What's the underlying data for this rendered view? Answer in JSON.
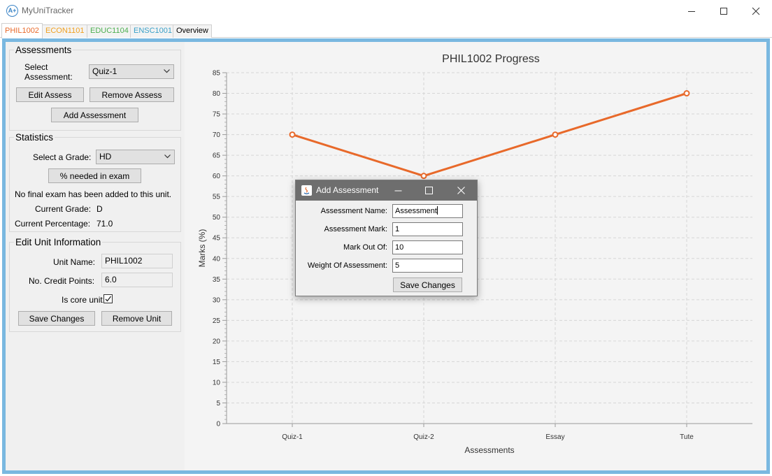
{
  "window": {
    "app_icon_glyph": "A+",
    "title": "MyUniTracker"
  },
  "tabs": [
    {
      "label": "PHIL1002",
      "color": "#e8692a",
      "active": true
    },
    {
      "label": "ECON1101",
      "color": "#f0a020",
      "active": false
    },
    {
      "label": "EDUC1104",
      "color": "#4caf50",
      "active": false
    },
    {
      "label": "ENSC1001",
      "color": "#3aa0c8",
      "active": false
    },
    {
      "label": "Overview",
      "color": "#000000",
      "active": false
    }
  ],
  "assessments_panel": {
    "title": "Assessments",
    "select_label": "Select Assessment:",
    "selected": "Quiz-1",
    "edit_button": "Edit Assess",
    "remove_button": "Remove Assess",
    "add_button": "Add Assessment"
  },
  "statistics_panel": {
    "title": "Statistics",
    "grade_label": "Select a Grade:",
    "grade_selected": "HD",
    "needed_button": "% needed in exam",
    "exam_message": "No final exam has been added to this unit.",
    "current_grade_label": "Current Grade:",
    "current_grade": "D",
    "current_pct_label": "Current Percentage:",
    "current_pct": "71.0"
  },
  "unit_panel": {
    "title": "Edit Unit Information",
    "name_label": "Unit Name:",
    "name_value": "PHIL1002",
    "credits_label": "No. Credit Points:",
    "credits_value": "6.0",
    "core_label": "Is core unit:",
    "core_checked": true,
    "save_button": "Save Changes",
    "remove_button": "Remove Unit"
  },
  "chart_data": {
    "type": "line",
    "title": "PHIL1002 Progress",
    "xlabel": "Assessments",
    "ylabel": "Marks (%)",
    "categories": [
      "Quiz-1",
      "Quiz-2",
      "Essay",
      "Tute"
    ],
    "series": [
      {
        "values": [
          70,
          60,
          70,
          80
        ],
        "color": "#e8692a"
      }
    ],
    "ylim": [
      0,
      85
    ],
    "yticks": [
      0,
      5,
      10,
      15,
      20,
      25,
      30,
      35,
      40,
      45,
      50,
      55,
      60,
      65,
      70,
      75,
      80,
      85
    ],
    "grid": true
  },
  "dialog": {
    "title": "Add Assessment",
    "fields": [
      {
        "label": "Assessment Name:",
        "value": "Assessment"
      },
      {
        "label": "Assessment Mark:",
        "value": "1"
      },
      {
        "label": "Mark Out Of:",
        "value": "10"
      },
      {
        "label": "Weight Of Assessment:",
        "value": "5"
      }
    ],
    "save_button": "Save Changes"
  }
}
